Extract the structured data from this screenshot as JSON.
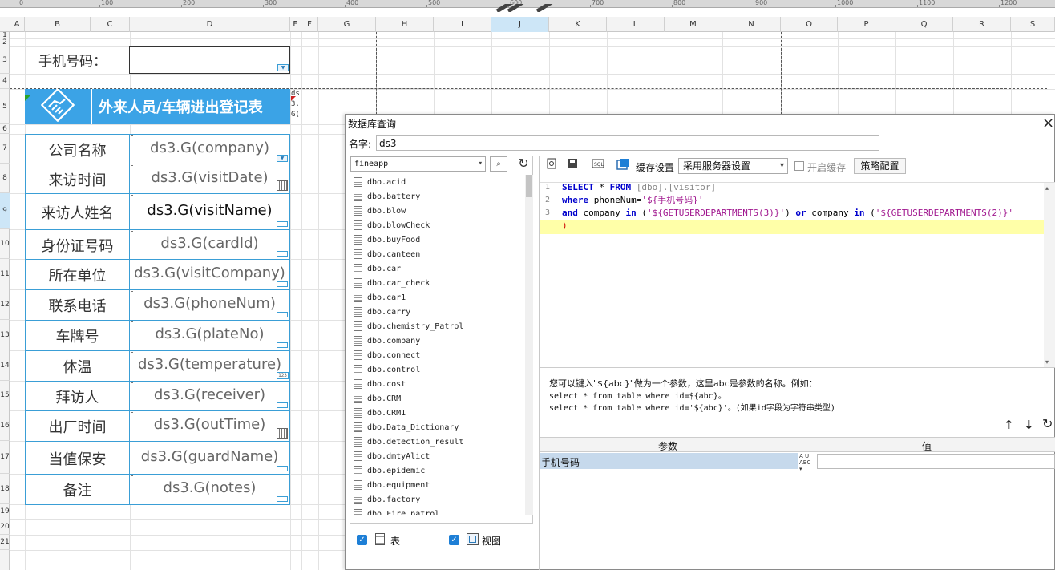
{
  "ruler": {
    "ticks": [
      "0",
      "100",
      "200",
      "300",
      "400",
      "500",
      "600",
      "700",
      "800",
      "900",
      "1000",
      "1100",
      "1200"
    ]
  },
  "columns": [
    "A",
    "B",
    "C",
    "D",
    "E",
    "F",
    "G",
    "H",
    "I",
    "J",
    "K",
    "L",
    "M",
    "N",
    "O",
    "P",
    "Q",
    "R",
    "S"
  ],
  "rows": [
    "1",
    "2",
    "3",
    "4",
    "5",
    "6",
    "7",
    "8",
    "9",
    "10",
    "11",
    "12",
    "13",
    "14",
    "15",
    "16",
    "17",
    "18",
    "19",
    "20",
    "21"
  ],
  "sheet": {
    "phone_label": "手机号码：",
    "form_title": "外来人员/车辆进出登记表",
    "corner_text": "ds\n3.\nG(",
    "fields": [
      {
        "label": "公司名称",
        "value": "ds3.G(company)"
      },
      {
        "label": "来访时间",
        "value": "ds3.G(visitDate)"
      },
      {
        "label": "来访人姓名",
        "value": "ds3.G(visitName)"
      },
      {
        "label": "身份证号码",
        "value": "ds3.G(cardId)"
      },
      {
        "label": "所在单位",
        "value": "ds3.G(visitCompany)"
      },
      {
        "label": "联系电话",
        "value": "ds3.G(phoneNum)"
      },
      {
        "label": "车牌号",
        "value": "ds3.G(plateNo)"
      },
      {
        "label": "体温",
        "value": "ds3.G(temperature)"
      },
      {
        "label": "拜访人",
        "value": "ds3.G(receiver)"
      },
      {
        "label": "出厂时间",
        "value": "ds3.G(outTime)"
      },
      {
        "label": "当值保安",
        "value": "ds3.G(guardName)"
      },
      {
        "label": "备注",
        "value": "ds3.G(notes)"
      }
    ]
  },
  "dialog": {
    "title": "数据库查询",
    "close": "×",
    "name_label": "名字:",
    "name_value": "ds3",
    "connection": "fineapp",
    "tables": [
      "dbo.acid",
      "dbo.battery",
      "dbo.blow",
      "dbo.blowCheck",
      "dbo.buyFood",
      "dbo.canteen",
      "dbo.car",
      "dbo.car_check",
      "dbo.car1",
      "dbo.carry",
      "dbo.chemistry_Patrol",
      "dbo.company",
      "dbo.connect",
      "dbo.control",
      "dbo.cost",
      "dbo.CRM",
      "dbo.CRM1",
      "dbo.Data_Dictionary",
      "dbo.detection_result",
      "dbo.dmtyAlict",
      "dbo.epidemic",
      "dbo.equipment",
      "dbo.factory",
      "dbo.Fire_patrol"
    ],
    "check_table": "表",
    "check_view": "视图",
    "cache_label": "缓存设置",
    "cache_option": "采用服务器设置",
    "enable_cache": "开启缓存",
    "strategy": "策略配置",
    "sql": {
      "line_numbers": [
        "1",
        "2",
        "3"
      ],
      "line1_kw1": "SELECT",
      "line1_mid": " * ",
      "line1_kw2": "FROM",
      "line1_rest": " [dbo].[visitor]",
      "line2_kw": "where",
      "line2_mid": " phoneNum=",
      "line2_str": "'${手机号码}'",
      "line3_kw1": "and",
      "line3_a": " company ",
      "line3_kw2": "in",
      "line3_b": " (",
      "line3_str1": "'${GETUSERDEPARTMENTS(3)}'",
      "line3_c": ") ",
      "line3_kw3": "or",
      "line3_d": " company ",
      "line3_kw4": "in",
      "line3_e": " (",
      "line3_str2": "'${GETUSERDEPARTMENTS(2)}'",
      "line4": ")"
    },
    "hint1": "您可以键入\"${abc}\"做为一个参数，这里abc是参数的名称。例如：",
    "hint2": "select * from table where id=${abc}。",
    "hint3": "select * from table where id='${abc}'。(如果id字段为字符串类型)",
    "param_header": "参数",
    "value_header": "值",
    "param_name": "手机号码",
    "param_value": ""
  }
}
